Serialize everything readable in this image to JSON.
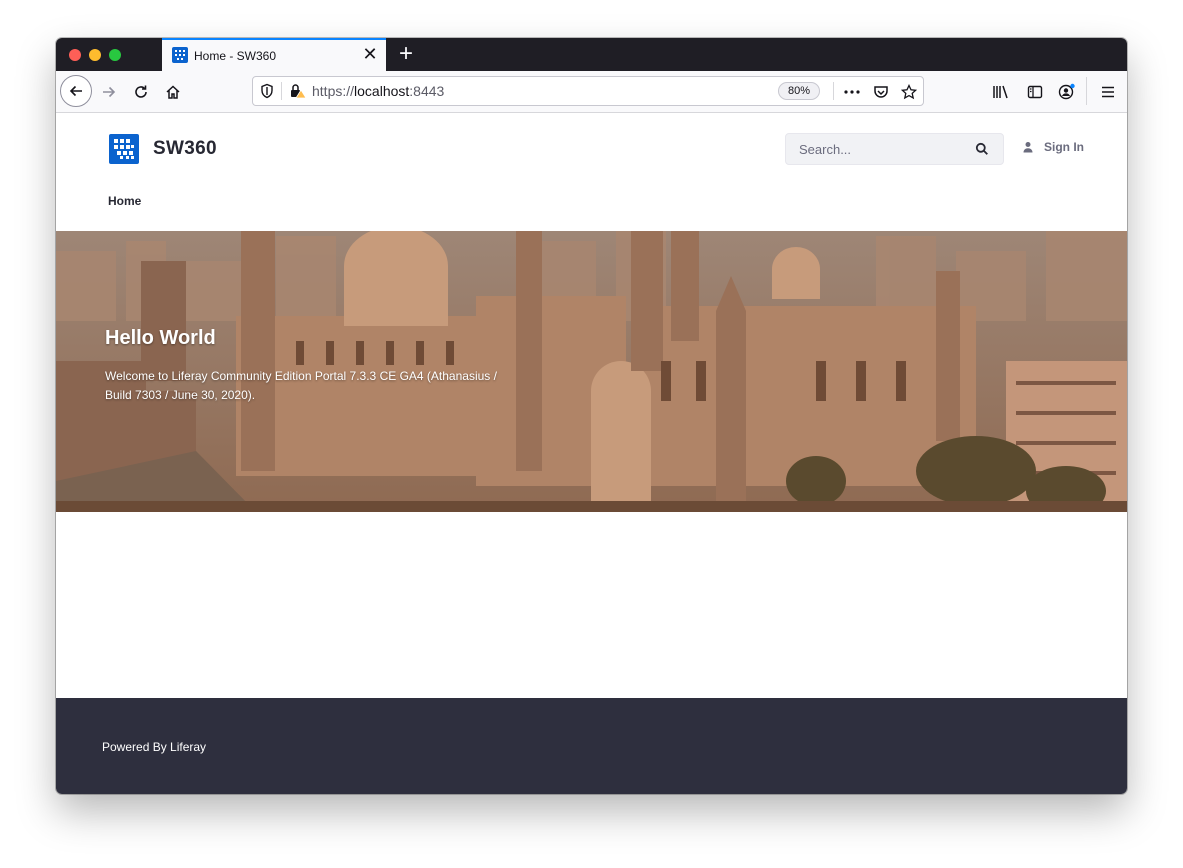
{
  "browser": {
    "tab_title": "Home - SW360",
    "tab_close": "✕",
    "new_tab": "+",
    "url_scheme": "https://",
    "url_host": "localhost",
    "url_port": ":8443",
    "zoom": "80%"
  },
  "site": {
    "name": "SW360",
    "search_placeholder": "Search...",
    "sign_in": "Sign In",
    "nav": [
      "Home"
    ]
  },
  "hero": {
    "heading": "Hello World",
    "subtitle": "Welcome to Liferay Community Edition Portal 7.3.3 CE GA4 (Athanasius / Build 7303 / June 30, 2020)."
  },
  "footer": {
    "text": "Powered By Liferay"
  },
  "colors": {
    "brand": "#0b63ce",
    "footer_bg": "#2e2f3e",
    "tab_accent": "#0a84ff"
  }
}
